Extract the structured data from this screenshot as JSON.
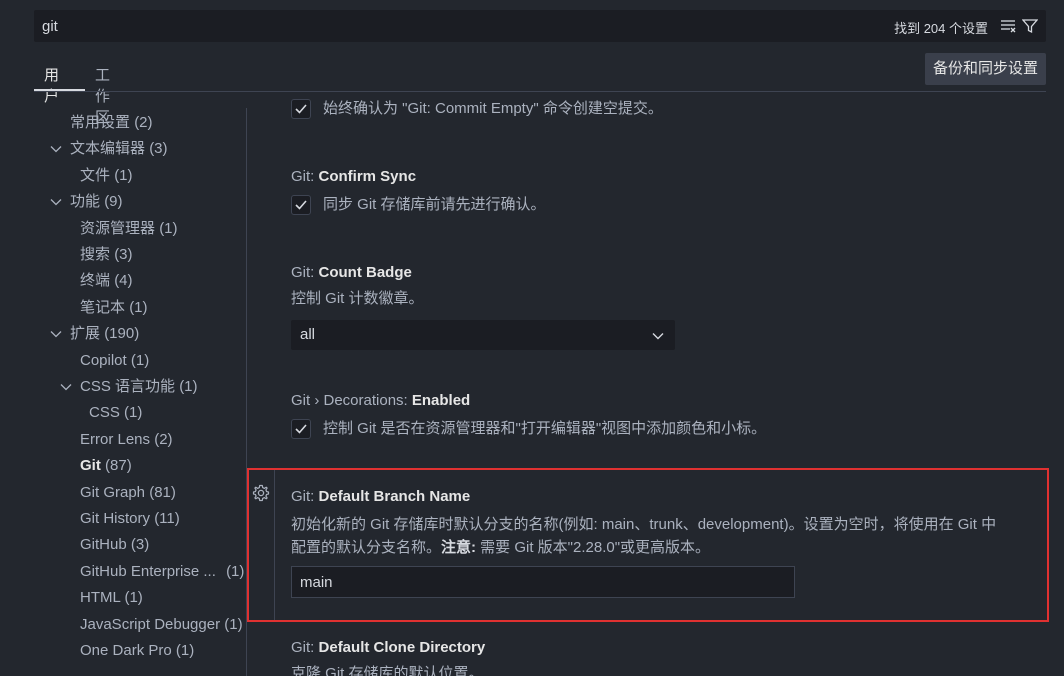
{
  "search": {
    "value": "git",
    "result_count": "找到 204 个设置"
  },
  "tabs": [
    {
      "label": "用户"
    },
    {
      "label": "工作区"
    }
  ],
  "sync_button": {
    "label": "备份和同步设置"
  },
  "toc": [
    {
      "label": "常用设置",
      "count": "(2)"
    },
    {
      "label": "文本编辑器",
      "count": "(3)"
    },
    {
      "label": "文件",
      "count": "(1)"
    },
    {
      "label": "功能",
      "count": "(9)"
    },
    {
      "label": "资源管理器",
      "count": "(1)"
    },
    {
      "label": "搜索",
      "count": "(3)"
    },
    {
      "label": "终端",
      "count": "(4)"
    },
    {
      "label": "笔记本",
      "count": "(1)"
    },
    {
      "label": "扩展",
      "count": "(190)"
    },
    {
      "label": "Copilot",
      "count": "(1)"
    },
    {
      "label": "CSS 语言功能",
      "count": "(1)"
    },
    {
      "label": "CSS",
      "count": "(1)"
    },
    {
      "label": "Error Lens",
      "count": "(2)"
    },
    {
      "label": "Git",
      "count": "(87)"
    },
    {
      "label": "Git Graph",
      "count": "(81)"
    },
    {
      "label": "Git History",
      "count": "(11)"
    },
    {
      "label": "GitHub",
      "count": "(3)"
    },
    {
      "label": "GitHub Enterprise ...",
      "count": "(1)"
    },
    {
      "label": "HTML",
      "count": "(1)"
    },
    {
      "label": "JavaScript Debugger",
      "count": "(1)"
    },
    {
      "label": "One Dark Pro",
      "count": "(1)"
    }
  ],
  "settings": {
    "commit_empty": {
      "label": "始终确认为 \"Git: Commit Empty\" 命令创建空提交。",
      "checked": true
    },
    "confirm_sync": {
      "category": "Git: ",
      "name": "Confirm Sync",
      "label": "同步 Git 存储库前请先进行确认。",
      "checked": true
    },
    "count_badge": {
      "category": "Git: ",
      "name": "Count Badge",
      "description": "控制 Git 计数徽章。",
      "value": "all"
    },
    "decorations": {
      "category": "Git › Decorations: ",
      "name": "Enabled",
      "label": "控制 Git 是否在资源管理器和\"打开编辑器\"视图中添加颜色和小标。",
      "checked": true
    },
    "default_branch": {
      "category": "Git: ",
      "name": "Default Branch Name",
      "description_line1": "初始化新的 Git 存储库时默认分支的名称(例如: main、trunk、development)。设置为空时，将使用在 Git 中",
      "description_line2_a": "配置的默认分支名称。",
      "description_line2_b": "注意:",
      "description_line2_c": " 需要 Git 版本\"2.28.0\"或更高版本。",
      "value": "main"
    },
    "clone_dir": {
      "category": "Git: ",
      "name": "Default Clone Directory",
      "description": "克隆 Git 存储库的默认位置。"
    }
  },
  "colors": {
    "accent": "#d7dae0",
    "focus_border": "#e03131",
    "background": "#23272e"
  }
}
